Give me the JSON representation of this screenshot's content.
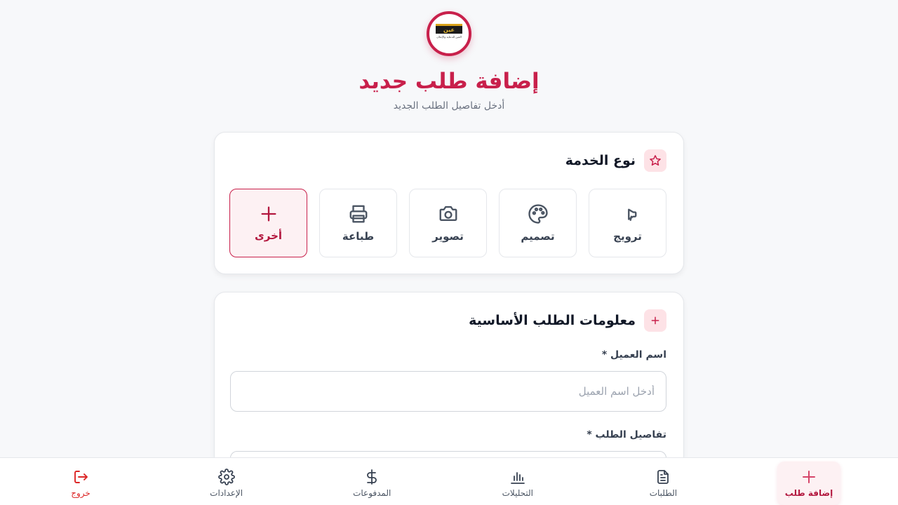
{
  "header": {
    "logo_text": "عين",
    "logo_caption": "العين للدعاية والإعلان",
    "title": "إضافة طلب جديد",
    "subtitle": "أدخل تفاصيل الطلب الجديد"
  },
  "service_type": {
    "title": "نوع الخدمة",
    "icon": "star-icon",
    "options": [
      {
        "label": "ترويج",
        "icon": "megaphone-icon",
        "selected": false
      },
      {
        "label": "تصميم",
        "icon": "palette-icon",
        "selected": false
      },
      {
        "label": "تصوير",
        "icon": "camera-icon",
        "selected": false
      },
      {
        "label": "طباعة",
        "icon": "printer-icon",
        "selected": false
      },
      {
        "label": "أخرى",
        "icon": "plus-icon",
        "selected": true
      }
    ]
  },
  "basic_info": {
    "title": "معلومات الطلب الأساسية",
    "icon": "plus-icon",
    "client_name_label": "اسم العميل *",
    "client_name_placeholder": "أدخل اسم العميل",
    "client_name_value": "",
    "order_details_label": "تفاصيل الطلب *"
  },
  "bottom_nav": [
    {
      "label": "إضافة طلب",
      "icon": "plus-icon",
      "active": true
    },
    {
      "label": "الطلبات",
      "icon": "document-icon",
      "active": false
    },
    {
      "label": "التحليلات",
      "icon": "bar-chart-icon",
      "active": false
    },
    {
      "label": "المدفوعات",
      "icon": "dollar-icon",
      "active": false
    },
    {
      "label": "الإعدادات",
      "icon": "gear-icon",
      "active": false
    },
    {
      "label": "خروج",
      "icon": "logout-icon",
      "active": false
    }
  ],
  "colors": {
    "accent": "#c8204b",
    "accent_light": "#fde2e6",
    "background": "#f7f8fa",
    "logout": "#dc2626"
  }
}
